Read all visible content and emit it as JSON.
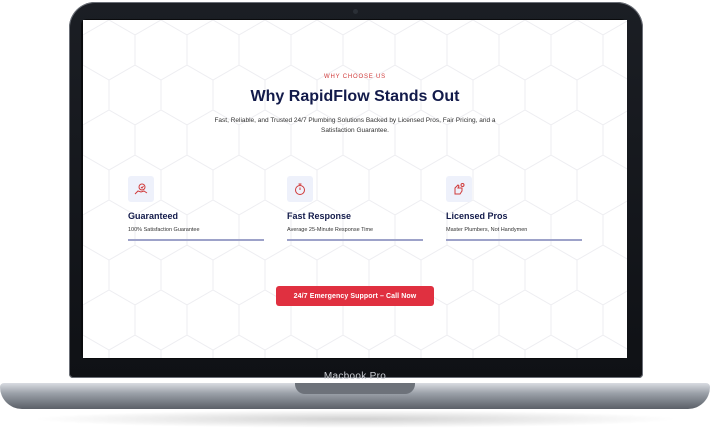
{
  "laptop": {
    "brand": "Macbook Pro"
  },
  "section": {
    "eyebrow": "WHY CHOOSE US",
    "title": "Why RapidFlow Stands Out",
    "subtitle": "Fast, Reliable, and Trusted 24/7 Plumbing Solutions Backed by Licensed Pros, Fair Pricing, and a Satisfaction Guarantee."
  },
  "features": [
    {
      "icon": "guarantee-hand-icon",
      "title": "Guaranteed",
      "desc": "100% Satisfaction Guarantee"
    },
    {
      "icon": "stopwatch-icon",
      "title": "Fast Response",
      "desc": "Average 25-Minute Response Time"
    },
    {
      "icon": "licensed-hand-icon",
      "title": "Licensed Pros",
      "desc": "Master Plumbers, Not Handymen"
    }
  ],
  "cta": {
    "label": "24/7 Emergency Support – Call Now"
  },
  "colors": {
    "navy": "#121a4a",
    "accent_red": "#e03040",
    "icon_bg": "#eef1fb",
    "divider": "#9da2c9"
  }
}
